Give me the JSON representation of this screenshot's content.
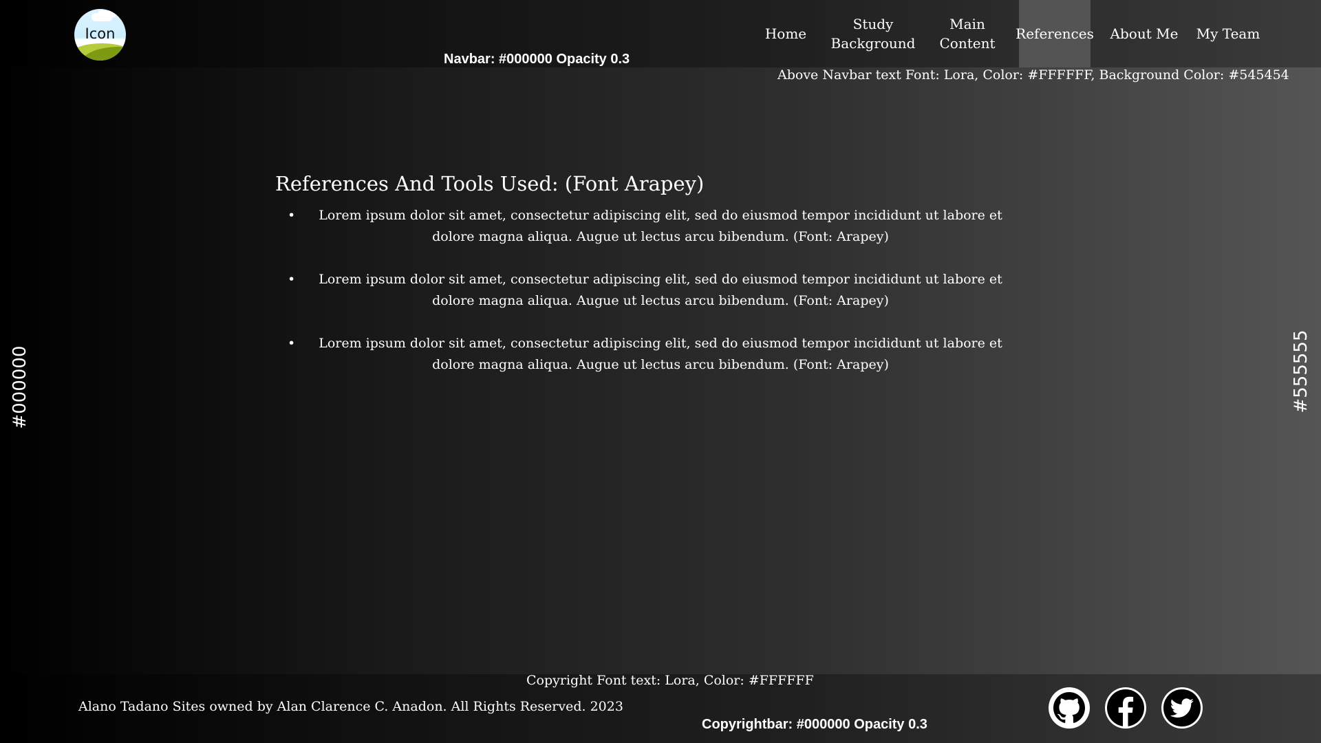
{
  "navbar": {
    "logo_label": "Icon",
    "note": "Navbar: #000000 Opacity 0.3",
    "items": [
      {
        "label": "Home"
      },
      {
        "label": "Study\nBackground"
      },
      {
        "label": "Main\nContent"
      },
      {
        "label": "References",
        "active": true
      },
      {
        "label": "About Me"
      },
      {
        "label": "My Team"
      }
    ],
    "above_note": "Above Navbar text Font: Lora, Color: #FFFFFF, Background Color: #545454"
  },
  "main": {
    "heading": "References And Tools Used: (Font Arapey)",
    "items": [
      "Lorem ipsum dolor sit amet, consectetur adipiscing elit, sed do eiusmod tempor incididunt ut labore et dolore magna aliqua. Augue ut lectus arcu bibendum. (Font: Arapey)",
      "Lorem ipsum dolor sit amet, consectetur adipiscing elit, sed do eiusmod tempor incididunt ut labore et dolore magna aliqua. Augue ut lectus arcu bibendum. (Font: Arapey)",
      "Lorem ipsum dolor sit amet, consectetur adipiscing elit, sed do eiusmod tempor incididunt ut labore et dolore magna aliqua. Augue ut lectus arcu bibendum. (Font: Arapey)"
    ]
  },
  "side_labels": {
    "left": "#000000",
    "right": "#555555"
  },
  "footer": {
    "font_note": "Copyright Font text: Lora, Color: #FFFFFF",
    "copyright": "Alano Tadano Sites owned by Alan Clarence C. Anadon. All Rights Reserved. 2023",
    "bar_note": "Copyrightbar: #000000 Opacity 0.3",
    "social": [
      {
        "icon": "github-icon"
      },
      {
        "icon": "facebook-icon"
      },
      {
        "icon": "twitter-icon"
      }
    ]
  },
  "colors": {
    "gradient_start": "#000000",
    "gradient_end": "#555555",
    "active_nav_bg": "#545454",
    "text": "#FFFFFF"
  }
}
